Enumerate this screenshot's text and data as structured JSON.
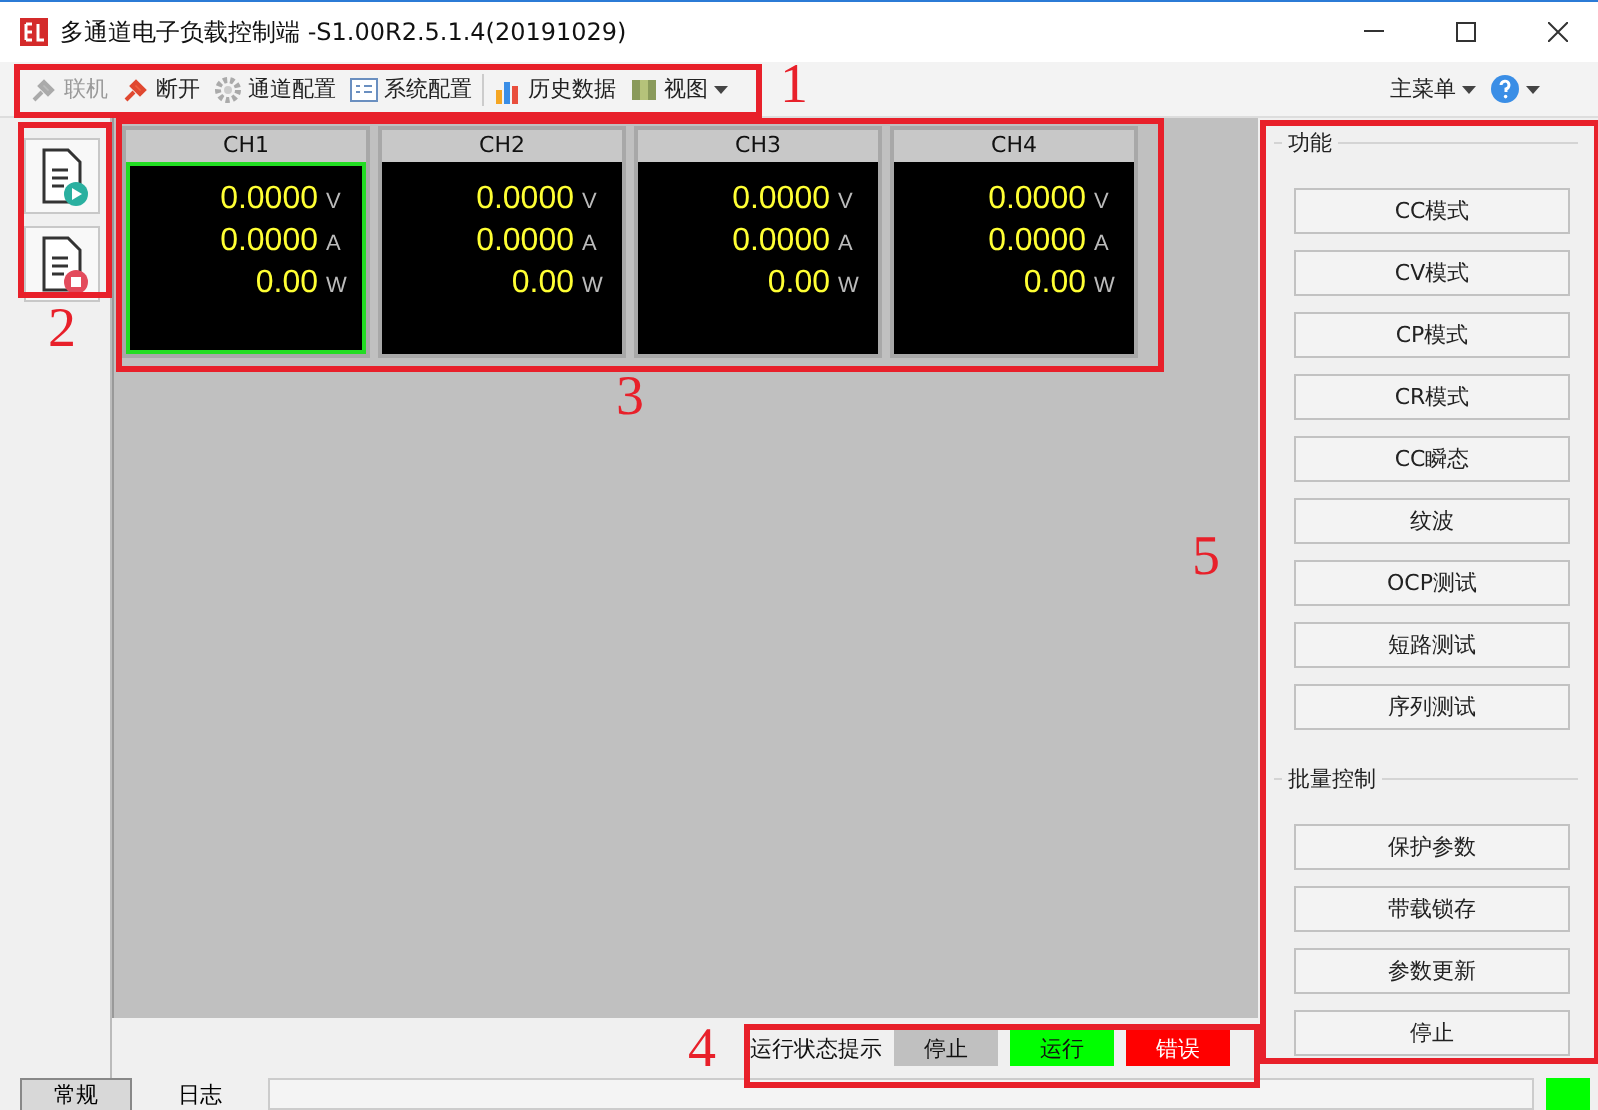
{
  "window": {
    "title": "多通道电子负载控制端 -S1.00R2.5.1.4(20191029)"
  },
  "toolbar": {
    "items": [
      {
        "kind": "connect",
        "label": "联机",
        "disabled": true
      },
      {
        "kind": "disconnect",
        "label": "断开",
        "disabled": false
      },
      {
        "kind": "gear",
        "label": "通道配置",
        "disabled": false
      },
      {
        "kind": "window",
        "label": "系统配置",
        "disabled": false
      },
      {
        "kind": "chart",
        "label": "历史数据",
        "disabled": false
      },
      {
        "kind": "view",
        "label": "视图",
        "disabled": false
      }
    ],
    "main_menu": "主菜单"
  },
  "side_buttons": [
    {
      "kind": "start"
    },
    {
      "kind": "stop"
    }
  ],
  "channels": [
    {
      "name": "CH1",
      "selected": true,
      "voltage": "0.0000",
      "voltage_unit": "V",
      "current": "0.0000",
      "current_unit": "A",
      "power": "0.00",
      "power_unit": "W"
    },
    {
      "name": "CH2",
      "selected": false,
      "voltage": "0.0000",
      "voltage_unit": "V",
      "current": "0.0000",
      "current_unit": "A",
      "power": "0.00",
      "power_unit": "W"
    },
    {
      "name": "CH3",
      "selected": false,
      "voltage": "0.0000",
      "voltage_unit": "V",
      "current": "0.0000",
      "current_unit": "A",
      "power": "0.00",
      "power_unit": "W"
    },
    {
      "name": "CH4",
      "selected": false,
      "voltage": "0.0000",
      "voltage_unit": "V",
      "current": "0.0000",
      "current_unit": "A",
      "power": "0.00",
      "power_unit": "W"
    }
  ],
  "status_hints": {
    "label": "运行状态提示",
    "items": [
      {
        "label": "停止",
        "color": "#c0c0c0"
      },
      {
        "label": "运行",
        "color": "#00ff00"
      },
      {
        "label": "错误",
        "color": "#ff0000"
      }
    ]
  },
  "functions": {
    "title": "功能",
    "buttons": [
      "CC模式",
      "CV模式",
      "CP模式",
      "CR模式",
      "CC瞬态",
      "纹波",
      "OCP测试",
      "短路测试",
      "序列测试"
    ]
  },
  "batch": {
    "title": "批量控制",
    "buttons": [
      "保护参数",
      "带载锁存",
      "参数更新",
      "停止"
    ]
  },
  "bottom_tabs": [
    {
      "label": "常规",
      "selected": true
    },
    {
      "label": "日志",
      "selected": false
    }
  ],
  "connection_indicator": {
    "color": "#00ff00"
  },
  "annotations": [
    {
      "label": "1"
    },
    {
      "label": "2"
    },
    {
      "label": "3"
    },
    {
      "label": "4"
    },
    {
      "label": "5"
    }
  ]
}
